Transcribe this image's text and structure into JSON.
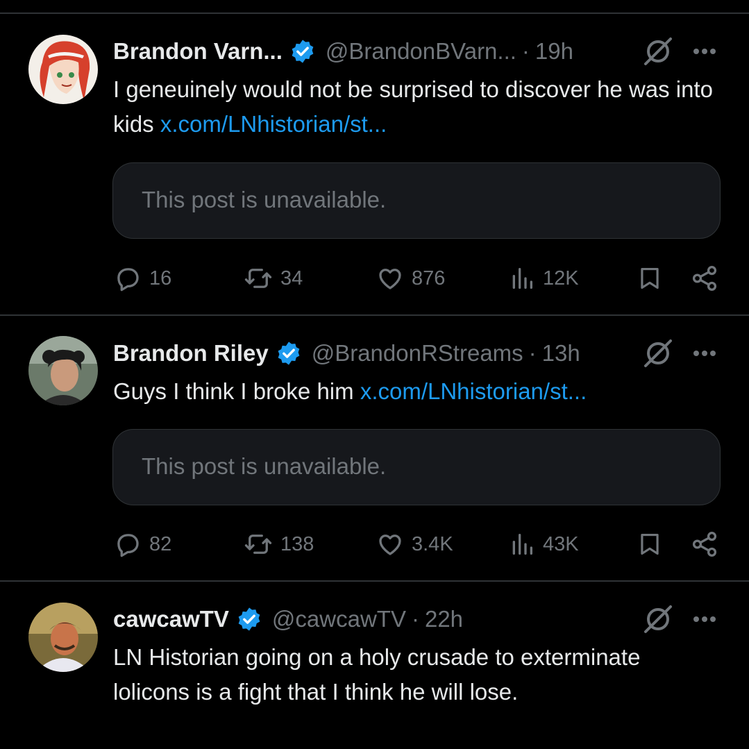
{
  "tweets": [
    {
      "name": "Brandon Varn...",
      "handle": "@BrandonBVarn...",
      "sep": "·",
      "time": "19h",
      "text": "I geneuinely would not be surprised to discover he was into kids ",
      "link": "x.com/LNhistorian/st...",
      "quote": "This post is unavailable.",
      "replies": "16",
      "reposts": "34",
      "likes": "876",
      "views": "12K"
    },
    {
      "name": "Brandon Riley",
      "handle": "@BrandonRStreams",
      "sep": "·",
      "time": "13h",
      "text": "Guys I think I broke him ",
      "link": "x.com/LNhistorian/st...",
      "quote": "This post is unavailable.",
      "replies": "82",
      "reposts": "138",
      "likes": "3.4K",
      "views": "43K"
    },
    {
      "name": "cawcawTV",
      "handle": "@cawcawTV",
      "sep": "·",
      "time": "22h",
      "text_line1": "LN Historian going on a holy crusade to exterminate",
      "text_line2": "lolicons is a fight that I think he will lose."
    }
  ],
  "colors": {
    "background": "#000000",
    "text": "#e7e9ea",
    "muted": "#71767b",
    "link": "#1d9bf0",
    "verified": "#1d9bf0",
    "divider": "#2f3336",
    "quote_bg": "#16181c"
  },
  "icons": [
    "verified-badge-icon",
    "grok-icon",
    "more-icon",
    "reply-icon",
    "repost-icon",
    "like-icon",
    "views-icon",
    "bookmark-icon",
    "share-icon"
  ]
}
